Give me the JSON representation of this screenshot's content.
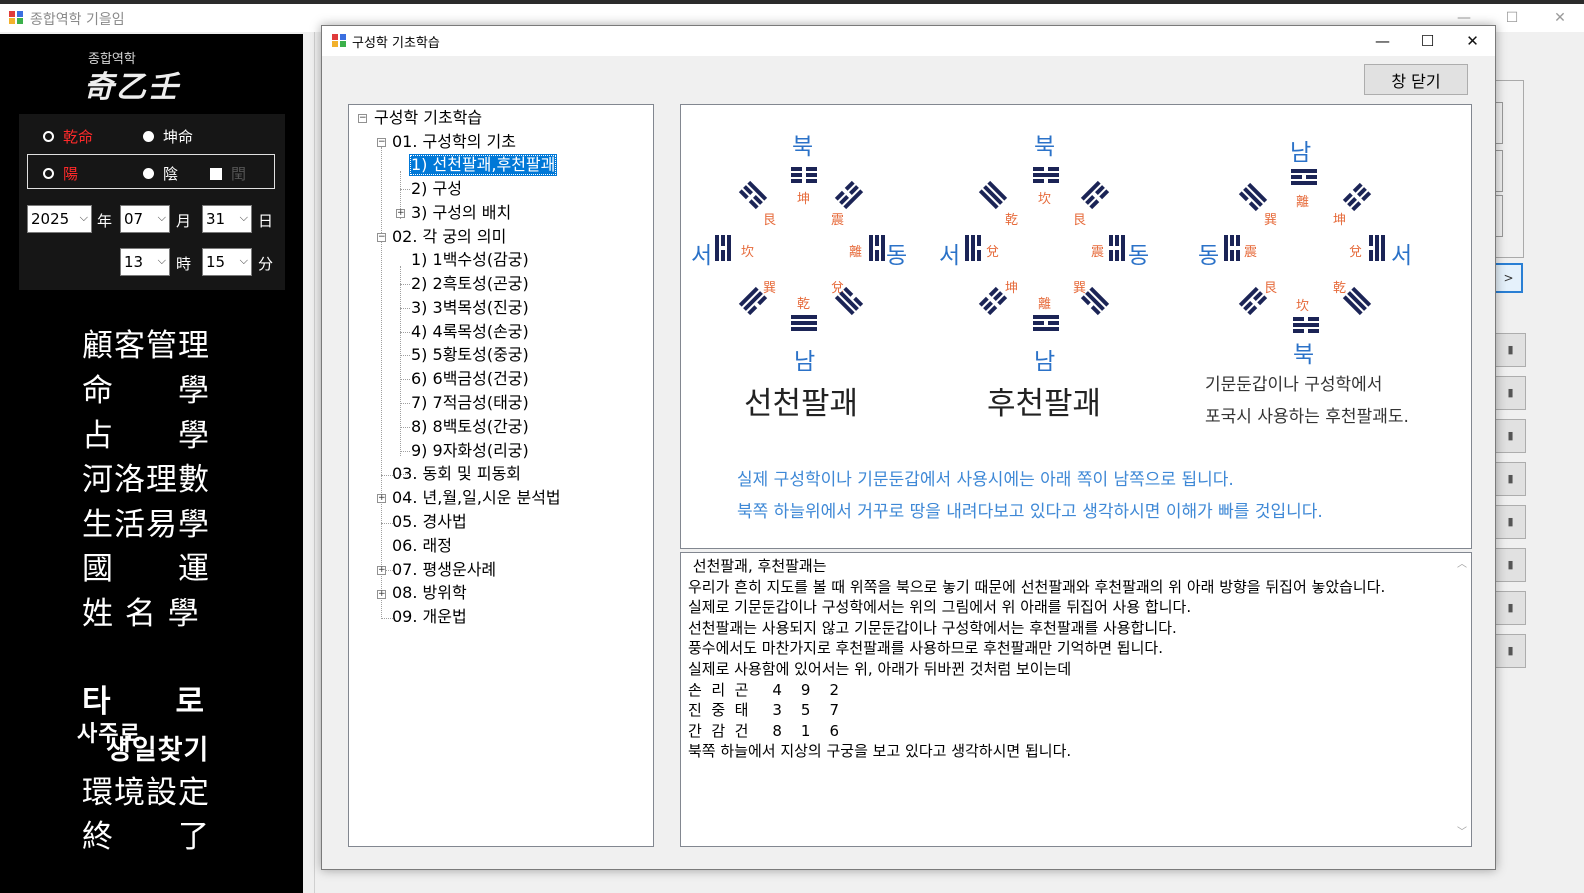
{
  "main_window": {
    "title": "종합역학 기을임",
    "controls": {
      "minimize": "—",
      "maximize": "☐",
      "close": "✕"
    }
  },
  "sidebar": {
    "logo_small": "종합역학",
    "logo_big": "奇乙壬",
    "gender": {
      "male": "乾命",
      "female": "坤命"
    },
    "yinyang": {
      "yang": "陽",
      "yin": "陰",
      "leap": "閏"
    },
    "date": {
      "year": "2025",
      "year_unit": "年",
      "month": "07",
      "month_unit": "月",
      "day": "31",
      "day_unit": "日",
      "hour": "13",
      "hour_unit": "時",
      "minute": "15",
      "minute_unit": "分"
    },
    "menu": [
      "顧客管理",
      "命　　學",
      "占　　學",
      "河洛理數",
      "生活易學",
      "國　　運",
      "姓 名 學",
      "타　　로",
      "사주로",
      "생일찾기",
      "環境設定",
      "終　　了"
    ]
  },
  "dialog": {
    "title": "구성학 기초학습",
    "controls": {
      "minimize": "—",
      "maximize": "☐",
      "close": "✕"
    },
    "close_button": "창 닫기",
    "tree": {
      "root": "구성학 기초학습",
      "n01": "01. 구성학의 기초",
      "n01_1": "1) 선천팔괘,후천팔괘",
      "n01_2": "2) 구성",
      "n01_3": "3) 구성의 배치",
      "n02": "02. 각 궁의 의미",
      "n02_1": "1) 1백수성(감궁)",
      "n02_2": "2) 2흑토성(곤궁)",
      "n02_3": "3) 3벽목성(진궁)",
      "n02_4": "4) 4록목성(손궁)",
      "n02_5": "5) 5황토성(중궁)",
      "n02_6": "6) 6백금성(건궁)",
      "n02_7": "7) 7적금성(태궁)",
      "n02_8": "8) 8백토성(간궁)",
      "n02_9": "9) 9자화성(리궁)",
      "n03": "03. 동회 및 피동회",
      "n04": "04. 년,월,일,시운 분석법",
      "n05": "05. 경사법",
      "n06": "06. 래정",
      "n07": "07. 평생운사례",
      "n08": "08. 방위학",
      "n09": "09. 개운법"
    },
    "figure": {
      "d1": {
        "top": "북",
        "bottom": "남",
        "left": "서",
        "right": "동",
        "top_g": "坤",
        "bottom_g": "乾",
        "left_g": "坎",
        "right_g": "離",
        "tl_g": "艮",
        "tr_g": "震",
        "bl_g": "巽",
        "br_g": "兌"
      },
      "d2": {
        "top": "북",
        "bottom": "남",
        "left": "서",
        "right": "동",
        "top_g": "坎",
        "bottom_g": "離",
        "left_g": "兌",
        "right_g": "震",
        "tl_g": "乾",
        "tr_g": "艮",
        "bl_g": "坤",
        "br_g": "巽"
      },
      "d3": {
        "top": "남",
        "bottom": "북",
        "left": "동",
        "right": "서",
        "top_g": "離",
        "bottom_g": "坎",
        "left_g": "震",
        "right_g": "兌",
        "tl_g": "巽",
        "tr_g": "坤",
        "bl_g": "艮",
        "br_g": "乾"
      },
      "caption1": "선천팔괘",
      "caption2": "후천팔괘",
      "caption3_l1": "기문둔갑이나 구성학에서",
      "caption3_l2": "포국시 사용하는 후천팔괘도.",
      "note1": "실제 구성학이나 기문둔갑에서 사용시에는 아래 쪽이 남쪽으로 됩니다.",
      "note2": "북쪽 하늘위에서 거꾸로 땅을 내려다보고 있다고 생각하시면 이해가 빠를 것입니다."
    },
    "text": [
      " 선천팔괘, 후천팔괘는",
      "우리가 흔히 지도를 볼 때 위쪽을 북으로 놓기 때문에 선천팔괘와 후천팔괘의 위 아래 방향을 뒤집어 놓았습니다.",
      "실제로 기문둔갑이나 구성학에서는 위의 그림에서 위 아래를 뒤집어 사용 합니다.",
      "선천팔괘는 사용되지 않고 기문둔갑이나 구성학에서는 후천팔괘를 사용합니다.",
      "풍수에서도 마찬가지로 후천팔괘를 사용하므로 후천팔괘만 기억하면 됩니다.",
      "실제로 사용함에 있어서는 위, 아래가 뒤바뀐 것처럼 보이는데",
      "손  리  곤     4    9    2",
      "진  중  태     3    5    7",
      "간  감  건     8    1    6",
      "북쪽 하늘에서 지상의 구궁을 보고 있다고 생각하시면 됩니다."
    ]
  },
  "colors": {
    "accent": "#0078d7",
    "direction": "#2b72c8",
    "trigram": "#1b2456",
    "gua_label": "#e66a3a",
    "note": "#3e88d6",
    "red_label": "#ff2a2a"
  }
}
